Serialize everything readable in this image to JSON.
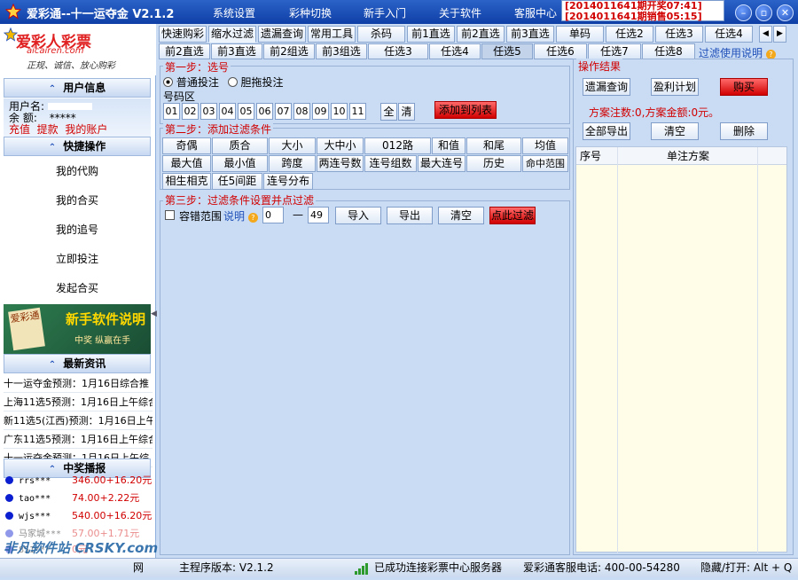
{
  "titlebar": {
    "app_title": "爱彩通--十一运夺金  V2.1.2",
    "menu": [
      "系统设置",
      "彩种切换",
      "新手入门",
      "关于软件",
      "客服中心"
    ],
    "issue_line1": "[2014011641期开奖07:41]",
    "issue_line2": "[2014011641期销售05:15]"
  },
  "logo": {
    "name": "爱彩人彩票",
    "url": "aicairen.com",
    "slogan": "正规、诚信、放心购彩"
  },
  "user_section": {
    "title": "用户信息",
    "username_label": "用户名:",
    "balance_label": "余  额:",
    "balance_value": "*****",
    "links": [
      "充值",
      "提款",
      "我的账户"
    ]
  },
  "quick_section": {
    "title": "快捷操作",
    "items": [
      "我的代购",
      "我的合买",
      "我的追号",
      "立即投注",
      "发起合买"
    ]
  },
  "banner": {
    "text_left": "爱彩通",
    "title": "新手软件说明",
    "subtitle": "中奖 纵赢在手"
  },
  "news_section": {
    "title": "最新资讯",
    "items": [
      "十一运夺金预测：1月16日综合推",
      "上海11选5预测：1月16日上午综合",
      "新11选5(江西)预测：1月16日上午",
      "广东11选5预测：1月16日上午综合",
      "十一运夺金预测：1月16日上午综"
    ]
  },
  "winners_section": {
    "title": "中奖播报",
    "items": [
      {
        "user": "rrs***",
        "amount": "346.00+16.20元"
      },
      {
        "user": "tao***",
        "amount": "74.00+2.22元"
      },
      {
        "user": "wjs***",
        "amount": "540.00+16.20元"
      },
      {
        "user": "马家城***",
        "amount": "57.00+1.71元"
      },
      {
        "user": "851***",
        "amount": "0元"
      }
    ]
  },
  "main_tabs": [
    {
      "label": "快速购彩",
      "selected": false
    },
    {
      "label": "缩水过滤",
      "selected": true
    },
    {
      "label": "遗漏查询",
      "selected": false
    },
    {
      "label": "常用工具",
      "selected": false
    },
    {
      "label": "杀码",
      "selected": false
    },
    {
      "label": "前1直选",
      "selected": false
    },
    {
      "label": "前2直选",
      "selected": false
    },
    {
      "label": "前3直选",
      "selected": false
    },
    {
      "label": "单码",
      "selected": false
    },
    {
      "label": "任选2",
      "selected": false
    },
    {
      "label": "任选3",
      "selected": false
    },
    {
      "label": "任选4",
      "selected": false
    }
  ],
  "sub_tabs": [
    {
      "label": "前2直选",
      "selected": false
    },
    {
      "label": "前3直选",
      "selected": false
    },
    {
      "label": "前2组选",
      "selected": false
    },
    {
      "label": "前3组选",
      "selected": false
    },
    {
      "label": "任选3",
      "selected": false
    },
    {
      "label": "任选4",
      "selected": false
    },
    {
      "label": "任选5",
      "selected": true
    },
    {
      "label": "任选6",
      "selected": false
    },
    {
      "label": "任选7",
      "selected": false
    },
    {
      "label": "任选8",
      "selected": false
    }
  ],
  "filter_help_link": "过滤使用说明",
  "step1": {
    "title": "第一步：选号",
    "radio_normal": "普通投注",
    "radio_dantuo": "胆拖投注",
    "number_area_label": "号码区",
    "numbers": [
      "01",
      "02",
      "03",
      "04",
      "05",
      "06",
      "07",
      "08",
      "09",
      "10",
      "11"
    ],
    "all_label": "全",
    "clear_label": "清",
    "add_label": "添加到列表"
  },
  "step2": {
    "title": "第二步：添加过滤条件",
    "filters": [
      "奇偶",
      "质合",
      "大小",
      "大中小",
      "012路",
      "和值",
      "和尾",
      "均值",
      "最大值",
      "最小值",
      "跨度",
      "两连号数",
      "连号组数",
      "最大连号",
      "历史",
      "命中范围",
      "相生相克",
      "任5间距",
      "连号分布"
    ]
  },
  "step3": {
    "title": "第三步：过滤条件设置并点过滤",
    "tolerance_label": "容错范围",
    "help_label": "说明",
    "range_from": "0",
    "range_dash": "—",
    "range_to": "49",
    "import_label": "导入",
    "export_label": "导出",
    "clear_label": "清空",
    "filter_label": "点此过滤"
  },
  "result": {
    "title": "操作结果",
    "btn_missing": "遗漏查询",
    "btn_profit": "盈利计划",
    "btn_buy": "购买",
    "summary": "方案注数:0,方案金额:0元。",
    "btn_export_all": "全部导出",
    "btn_clear": "清空",
    "btn_delete": "删除",
    "col_no": "序号",
    "col_plan": "单注方案"
  },
  "statusbar": {
    "left": "网",
    "version": "主程序版本: V2.1.2",
    "connection": "已成功连接彩票中心服务器",
    "phone": "爱彩通客服电话: 400-00-54280",
    "hotkey": "隐藏/打开: Alt + Q"
  },
  "watermark": "非凡软件站 CRSKY.com",
  "colors": {
    "accent_red": "#d10000",
    "title_blue": "#1f4fb8",
    "panel_bg": "#c9dcf4",
    "grid_bg": "#fffde8"
  }
}
